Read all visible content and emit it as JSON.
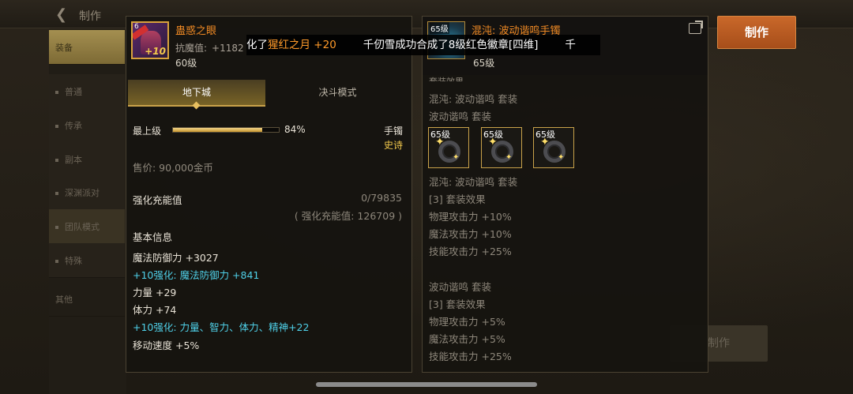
{
  "topbar": {
    "back_label": "制作"
  },
  "sidebar": {
    "items": [
      {
        "label": "装备"
      },
      {
        "label": "普通"
      },
      {
        "label": "传承"
      },
      {
        "label": "副本"
      },
      {
        "label": "深渊派对"
      },
      {
        "label": "团队模式"
      },
      {
        "label": "特殊"
      },
      {
        "label": "其他"
      }
    ]
  },
  "craft_button": "制作",
  "craft_button_secondary": "制作",
  "left_item": {
    "name": "蛊惑之眼",
    "icon_plus": "+10",
    "icon_level": "6",
    "resist_label": "抗魔值:",
    "resist_value": "+1182",
    "level": "60级",
    "tabs": {
      "active": "地下城",
      "inactive": "决斗模式"
    },
    "grade_label": "最上级",
    "grade_percent": "84%",
    "grade_fraction": 0.84,
    "slot_type": "手镯",
    "rarity": "史诗",
    "price": "售价: 90,000金币",
    "charge_label": "强化充能值",
    "charge_value": "0/79835",
    "charge_sub": "( 强化充能值: 126709 )",
    "basic_info_label": "基本信息",
    "stats": [
      {
        "text": "魔法防御力 +3027",
        "color": "white"
      },
      {
        "text": "+10强化: 魔法防御力 +841",
        "color": "cyan"
      },
      {
        "text": "力量 +29",
        "color": "white"
      },
      {
        "text": "体力 +74",
        "color": "white"
      },
      {
        "text": "+10强化: 力量、智力、体力、精神+22",
        "color": "cyan"
      },
      {
        "text": "移动速度 +5%",
        "color": "white"
      }
    ]
  },
  "right_item": {
    "icon_level": "65级",
    "name": "混沌: 波动谐鸣手镯",
    "level": "65级",
    "set_header": "套装效果",
    "set_line_1": "混沌: 波动谐鸣 套装",
    "set_line_2": "波动谐鸣 套装",
    "set_slots": [
      "65级",
      "65级",
      "65级"
    ],
    "set_block_1": {
      "title": "混沌: 波动谐鸣 套装",
      "effect_title": "[3] 套装效果",
      "lines": [
        "物理攻击力 +10%",
        "魔法攻击力 +10%",
        "技能攻击力 +25%"
      ]
    },
    "set_block_2": {
      "title": "波动谐鸣 套装",
      "effect_title": "[3] 套装效果",
      "lines": [
        "物理攻击力 +5%",
        "魔法攻击力 +5%",
        "技能攻击力 +25%"
      ]
    }
  },
  "ticker": {
    "part1": "化了",
    "highlight": "猩红之月 +20",
    "part2": "千仞雪成功合成了8级红色徽章[四维]",
    "part3": "千"
  }
}
